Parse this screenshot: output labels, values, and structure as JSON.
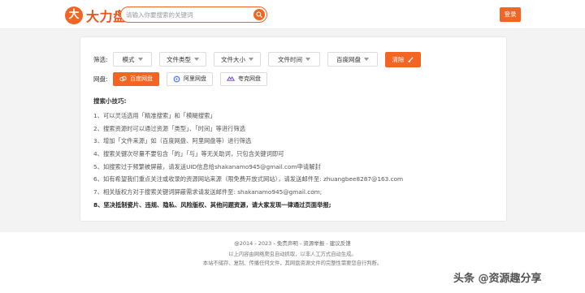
{
  "header": {
    "logo_mark": "大",
    "logo_text": "大力盘",
    "search_placeholder": "请输入你要搜索的关键词",
    "login_label": "登录"
  },
  "filters": {
    "label": "筛选:",
    "options": [
      "模式",
      "文件类型",
      "文件大小",
      "文件时间",
      "百度网盘"
    ],
    "clear_label": "清除"
  },
  "disks": {
    "label": "网盘:",
    "items": [
      "百度网盘",
      "阿里网盘",
      "夸克网盘"
    ]
  },
  "tips": {
    "title": "搜索小技巧:",
    "items": [
      "1、可以灵活选用「精准搜索」和「模糊搜索」",
      "2、搜索资源时可以通过资源「类型」、「时间」等进行筛选",
      "3、增加「文件来源」如（百度网盘、阿里网盘等）进行筛选",
      "4、搜索关键次尽量不要包含「的」「与」等无关助词，只包含关键词即可",
      "5、如搜索过于频繁被屏蔽，请发送UID信息给shakanamo945@gmail.com申请解封",
      "6、如有希望我们重点关注或收录的资源网站来源（限免费开放式网站），请发送邮件至: zhuangbee8287@163.com",
      "7、相关版权方对于搜索关键词屏蔽需求请发送邮件至: shakanamo945@gmail.com;",
      "8、坚决抵制瓷片、违规、隐私、风险版权、其他问题资源，请大家发现一律通过页面举报;"
    ]
  },
  "footer": {
    "links": "@2014 - 2023 - 免责声明 - 资源举报 - 建议反馈",
    "line1": "以上内容由网络爬虫自动抓取，以非人工方式自动生成。",
    "line2": "本站不储存、复制、传播任何文件，其网盘资源文件的完整性需要您自行判断。"
  },
  "watermark": "头条 @资源趣分享",
  "colors": {
    "accent": "#f26522",
    "background": "#f3f3f3"
  },
  "icons": [
    "search-icon",
    "clear-icon",
    "baidu-cloud-icon",
    "aliyun-icon",
    "quark-icon"
  ]
}
